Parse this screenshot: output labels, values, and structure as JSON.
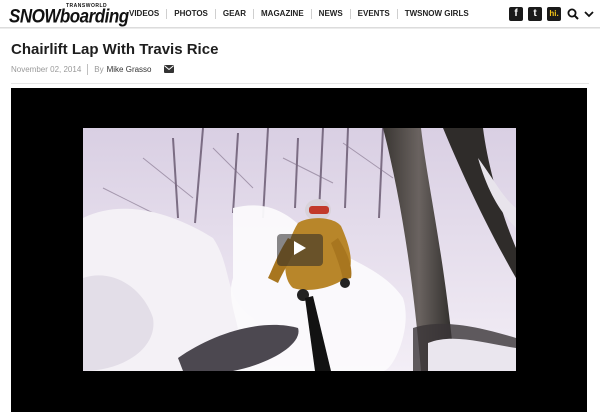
{
  "header": {
    "logo": {
      "small": "TRANSWORLD",
      "big": "SNOWboarding"
    },
    "nav": [
      "VIDEOS",
      "PHOTOS",
      "GEAR",
      "MAGAZINE",
      "NEWS",
      "EVENTS",
      "TWSNOW GIRLS"
    ],
    "social": {
      "facebook": "f",
      "twitter": "t",
      "hi": "hi."
    }
  },
  "article": {
    "title": "Chairlift Lap With Travis Rice",
    "date": "November 02, 2014",
    "by_label": "By",
    "author": "Mike Grasso"
  },
  "video": {
    "play_icon": "play-icon"
  },
  "colors": {
    "nav_text": "#222222",
    "player_bg": "#000000",
    "hi_badge": "#f2c318"
  }
}
